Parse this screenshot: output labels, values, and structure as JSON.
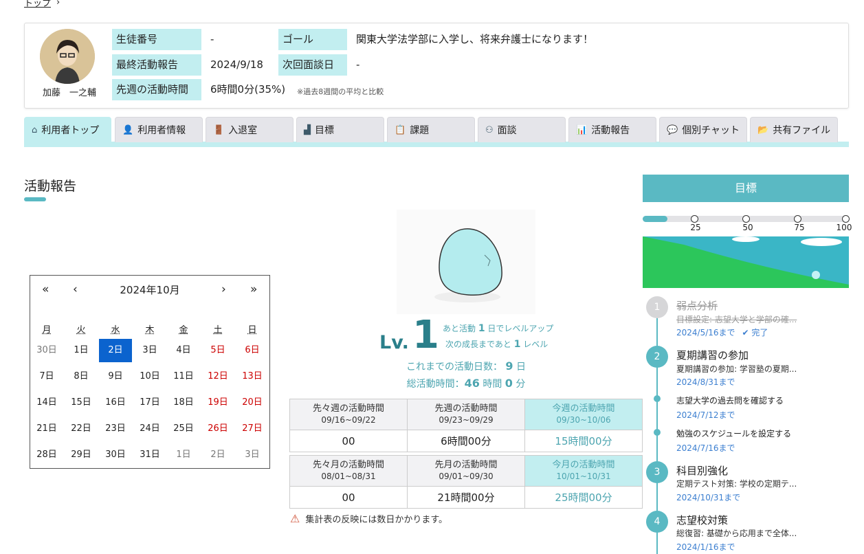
{
  "breadcrumb": {
    "home": "トップ",
    "sep": "›"
  },
  "profile": {
    "name": "加藤　一之輔",
    "labels": {
      "student_no": "生徒番号",
      "last_report": "最終活動報告",
      "last_week": "先週の活動時間",
      "goal": "ゴール",
      "next_interview": "次回面談日"
    },
    "values": {
      "student_no": "-",
      "last_report": "2024/9/18",
      "last_week": "6時間0分(35%)",
      "goal": "関東大学法学部に入学し、将来弁護士になります！",
      "next_interview": "-"
    },
    "note": "※過去8週間の平均と比較"
  },
  "tabs": [
    {
      "label": "利用者トップ",
      "icon": "⌂"
    },
    {
      "label": "利用者情報",
      "icon": "👤"
    },
    {
      "label": "入退室",
      "icon": "🚪"
    },
    {
      "label": "目標",
      "icon": "▟"
    },
    {
      "label": "課題",
      "icon": "📋"
    },
    {
      "label": "面談",
      "icon": "⚇"
    },
    {
      "label": "活動報告",
      "icon": "📊"
    },
    {
      "label": "個別チャット",
      "icon": "💬"
    },
    {
      "label": "共有ファイル",
      "icon": "📂"
    }
  ],
  "section_title": "活動報告",
  "calendar": {
    "title": "2024年10月",
    "nav": {
      "prev_year": "«",
      "prev": "‹",
      "next": "›",
      "next_year": "»"
    },
    "dow": [
      "月",
      "火",
      "水",
      "木",
      "金",
      "土",
      "日"
    ],
    "weeks": [
      [
        "30日",
        "1日",
        "2日",
        "3日",
        "4日",
        "5日",
        "6日"
      ],
      [
        "7日",
        "8日",
        "9日",
        "10日",
        "11日",
        "12日",
        "13日"
      ],
      [
        "14日",
        "15日",
        "16日",
        "17日",
        "18日",
        "19日",
        "20日"
      ],
      [
        "21日",
        "22日",
        "23日",
        "24日",
        "25日",
        "26日",
        "27日"
      ],
      [
        "28日",
        "29日",
        "30日",
        "31日",
        "1日",
        "2日",
        "3日"
      ]
    ],
    "today": "2日"
  },
  "level": {
    "label": "Lv.",
    "value": "1",
    "note1_pre": "あと活動",
    "note1_num": "1",
    "note1_post": "日でレベルアップ",
    "note2_pre": "次の成長まであと",
    "note2_num": "1",
    "note2_post": "レベル"
  },
  "stats": {
    "days_label": "これまでの活動日数：",
    "days_value": "9",
    "days_unit": "日",
    "total_label": "総活動時間：",
    "total_hours": "46",
    "total_hours_unit": "時間",
    "total_min": "0",
    "total_min_unit": "分"
  },
  "weekly": [
    {
      "title": "先々週の活動時間",
      "range": "09/16~09/22",
      "value": "00"
    },
    {
      "title": "先週の活動時間",
      "range": "09/23~09/29",
      "value": "6時間00分"
    },
    {
      "title": "今週の活動時間",
      "range": "09/30~10/06",
      "value": "15時間00分"
    }
  ],
  "monthly": [
    {
      "title": "先々月の活動時間",
      "range": "08/01~08/31",
      "value": "00"
    },
    {
      "title": "先月の活動時間",
      "range": "09/01~09/30",
      "value": "21時間00分"
    },
    {
      "title": "今月の活動時間",
      "range": "10/01~10/31",
      "value": "25時間00分"
    }
  ],
  "warning": "集計表の反映には数日かかります。",
  "goal_panel": {
    "title": "目標",
    "progress_percent": 12,
    "ticks": [
      "25",
      "50",
      "75",
      "100"
    ],
    "timeline": [
      {
        "num": "1",
        "title": "弱点分析",
        "desc": "目標設定: 志望大学と学部の確...",
        "date": "2024/5/16まで",
        "status": "完了"
      },
      {
        "num": "2",
        "title": "夏期講習の参加",
        "desc": "夏期講習の参加: 学習塾の夏期...",
        "date": "2024/8/31まで"
      },
      {
        "sub": "志望大学の過去問を確認する",
        "date": "2024/7/12まで"
      },
      {
        "sub": "勉強のスケジュールを設定する",
        "date": "2024/7/16まで"
      },
      {
        "num": "3",
        "title": "科目別強化",
        "desc": "定期テスト対策: 学校の定期テ...",
        "date": "2024/10/31まで"
      },
      {
        "num": "4",
        "title": "志望校対策",
        "desc": "総復習: 基礎から応用まで全体...",
        "date": "2024/1/16まで"
      }
    ]
  }
}
